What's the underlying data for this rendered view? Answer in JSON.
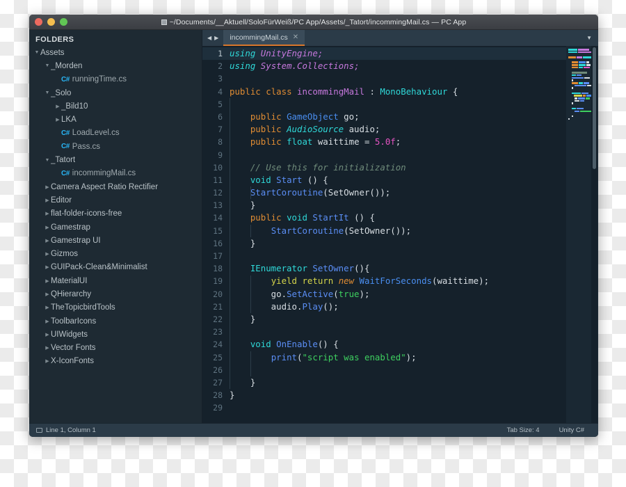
{
  "window": {
    "title": "~/Documents/__Aktuell/SoloFürWeiß/PC App/Assets/_Tatort/incommingMail.cs — PC App",
    "traffic_lights": [
      "close",
      "minimize",
      "zoom"
    ]
  },
  "sidebar": {
    "header": "FOLDERS",
    "items": [
      {
        "label": "Assets",
        "indent": 0,
        "type": "folder",
        "expanded": true
      },
      {
        "label": "_Morden",
        "indent": 1,
        "type": "folder",
        "expanded": true
      },
      {
        "label": "runningTime.cs",
        "indent": 2,
        "type": "file"
      },
      {
        "label": "_Solo",
        "indent": 1,
        "type": "folder",
        "expanded": true
      },
      {
        "label": "_Bild10",
        "indent": 2,
        "type": "folder",
        "expanded": false
      },
      {
        "label": "LKA",
        "indent": 2,
        "type": "folder",
        "expanded": false
      },
      {
        "label": "LoadLevel.cs",
        "indent": 2,
        "type": "file"
      },
      {
        "label": "Pass.cs",
        "indent": 2,
        "type": "file"
      },
      {
        "label": "_Tatort",
        "indent": 1,
        "type": "folder",
        "expanded": true
      },
      {
        "label": "incommingMail.cs",
        "indent": 2,
        "type": "file"
      },
      {
        "label": "Camera Aspect Ratio Rectifier",
        "indent": 1,
        "type": "folder",
        "expanded": false
      },
      {
        "label": "Editor",
        "indent": 1,
        "type": "folder",
        "expanded": false
      },
      {
        "label": "flat-folder-icons-free",
        "indent": 1,
        "type": "folder",
        "expanded": false
      },
      {
        "label": "Gamestrap",
        "indent": 1,
        "type": "folder",
        "expanded": false
      },
      {
        "label": "Gamestrap UI",
        "indent": 1,
        "type": "folder",
        "expanded": false
      },
      {
        "label": "Gizmos",
        "indent": 1,
        "type": "folder",
        "expanded": false
      },
      {
        "label": "GUIPack-Clean&Minimalist",
        "indent": 1,
        "type": "folder",
        "expanded": false
      },
      {
        "label": "MaterialUI",
        "indent": 1,
        "type": "folder",
        "expanded": false
      },
      {
        "label": "QHierarchy",
        "indent": 1,
        "type": "folder",
        "expanded": false
      },
      {
        "label": "TheTopicbirdTools",
        "indent": 1,
        "type": "folder",
        "expanded": false
      },
      {
        "label": "ToolbarIcons",
        "indent": 1,
        "type": "folder",
        "expanded": false
      },
      {
        "label": "UIWidgets",
        "indent": 1,
        "type": "folder",
        "expanded": false
      },
      {
        "label": "Vector Fonts",
        "indent": 1,
        "type": "folder",
        "expanded": false
      },
      {
        "label": "X-IconFonts",
        "indent": 1,
        "type": "folder",
        "expanded": false
      }
    ],
    "file_icon_label": "C#"
  },
  "tabbar": {
    "nav_prev": "◀",
    "nav_next": "▶",
    "tabs": [
      {
        "label": "incommingMail.cs",
        "active": true,
        "close": "✕"
      }
    ],
    "menu": "▼"
  },
  "editor": {
    "total_lines": 29,
    "active_line": 1,
    "lines": [
      {
        "n": 1,
        "tokens": [
          {
            "t": "using",
            "c": "k-using"
          },
          {
            "t": " "
          },
          {
            "t": "UnityEngine",
            "c": "k-ns"
          },
          {
            "t": ";",
            "c": "k-ns"
          }
        ]
      },
      {
        "n": 2,
        "tokens": [
          {
            "t": "using",
            "c": "k-using"
          },
          {
            "t": " "
          },
          {
            "t": "System.Collections",
            "c": "k-ns"
          },
          {
            "t": ";",
            "c": "k-ns"
          }
        ]
      },
      {
        "n": 3,
        "tokens": []
      },
      {
        "n": 4,
        "tokens": [
          {
            "t": "public",
            "c": "k-mod"
          },
          {
            "t": " "
          },
          {
            "t": "class",
            "c": "k-mod"
          },
          {
            "t": " "
          },
          {
            "t": "incommingMail",
            "c": "k-cls"
          },
          {
            "t": " : "
          },
          {
            "t": "MonoBehaviour",
            "c": "k-type"
          },
          {
            "t": " {"
          }
        ]
      },
      {
        "n": 5,
        "tokens": []
      },
      {
        "n": 6,
        "tokens": [
          {
            "t": "    "
          },
          {
            "t": "public",
            "c": "k-mod"
          },
          {
            "t": " "
          },
          {
            "t": "GameObject",
            "c": "k-obj"
          },
          {
            "t": " go;"
          }
        ]
      },
      {
        "n": 7,
        "tokens": [
          {
            "t": "    "
          },
          {
            "t": "public",
            "c": "k-mod"
          },
          {
            "t": " "
          },
          {
            "t": "AudioSource",
            "c": "k-typeit"
          },
          {
            "t": " audio;"
          }
        ]
      },
      {
        "n": 8,
        "tokens": [
          {
            "t": "    "
          },
          {
            "t": "public",
            "c": "k-mod"
          },
          {
            "t": " "
          },
          {
            "t": "float",
            "c": "k-type"
          },
          {
            "t": " waittime = "
          },
          {
            "t": "5.0f",
            "c": "k-num"
          },
          {
            "t": ";"
          }
        ]
      },
      {
        "n": 9,
        "tokens": []
      },
      {
        "n": 10,
        "tokens": [
          {
            "t": "    "
          },
          {
            "t": "// Use this for initialization",
            "c": "k-com"
          }
        ]
      },
      {
        "n": 11,
        "tokens": [
          {
            "t": "    "
          },
          {
            "t": "void",
            "c": "k-type"
          },
          {
            "t": " "
          },
          {
            "t": "Start",
            "c": "k-fn"
          },
          {
            "t": " () {"
          }
        ]
      },
      {
        "n": 12,
        "tokens": [
          {
            "t": "    "
          },
          {
            "t": "StartCoroutine",
            "c": "k-fn"
          },
          {
            "t": "(SetOwner());"
          }
        ]
      },
      {
        "n": 13,
        "tokens": [
          {
            "t": "    }"
          }
        ]
      },
      {
        "n": 14,
        "tokens": [
          {
            "t": "    "
          },
          {
            "t": "public",
            "c": "k-mod"
          },
          {
            "t": " "
          },
          {
            "t": "void",
            "c": "k-type"
          },
          {
            "t": " "
          },
          {
            "t": "StartIt",
            "c": "k-fn"
          },
          {
            "t": " () {"
          }
        ]
      },
      {
        "n": 15,
        "tokens": [
          {
            "t": "        "
          },
          {
            "t": "StartCoroutine",
            "c": "k-fn"
          },
          {
            "t": "(SetOwner());"
          }
        ]
      },
      {
        "n": 16,
        "tokens": [
          {
            "t": "    }"
          }
        ]
      },
      {
        "n": 17,
        "tokens": []
      },
      {
        "n": 18,
        "tokens": [
          {
            "t": "    "
          },
          {
            "t": "IEnumerator",
            "c": "k-type"
          },
          {
            "t": " "
          },
          {
            "t": "SetOwner",
            "c": "k-fn"
          },
          {
            "t": "(){"
          }
        ]
      },
      {
        "n": 19,
        "tokens": [
          {
            "t": "        "
          },
          {
            "t": "yield return",
            "c": "k-yield"
          },
          {
            "t": " "
          },
          {
            "t": "new",
            "c": "k-new"
          },
          {
            "t": " "
          },
          {
            "t": "WaitForSeconds",
            "c": "k-obj"
          },
          {
            "t": "(waittime);"
          }
        ]
      },
      {
        "n": 20,
        "tokens": [
          {
            "t": "        go."
          },
          {
            "t": "SetActive",
            "c": "k-fn"
          },
          {
            "t": "("
          },
          {
            "t": "true",
            "c": "k-bool"
          },
          {
            "t": ");"
          }
        ]
      },
      {
        "n": 21,
        "tokens": [
          {
            "t": "        audio."
          },
          {
            "t": "Play",
            "c": "k-fn"
          },
          {
            "t": "();"
          }
        ]
      },
      {
        "n": 22,
        "tokens": [
          {
            "t": "    }"
          }
        ]
      },
      {
        "n": 23,
        "tokens": []
      },
      {
        "n": 24,
        "tokens": [
          {
            "t": "    "
          },
          {
            "t": "void",
            "c": "k-type"
          },
          {
            "t": " "
          },
          {
            "t": "OnEnable",
            "c": "k-fn"
          },
          {
            "t": "() {"
          }
        ]
      },
      {
        "n": 25,
        "tokens": [
          {
            "t": "        "
          },
          {
            "t": "print",
            "c": "k-fn"
          },
          {
            "t": "("
          },
          {
            "t": "\"script was enabled\"",
            "c": "k-str"
          },
          {
            "t": ");"
          }
        ]
      },
      {
        "n": 26,
        "tokens": []
      },
      {
        "n": 27,
        "tokens": [
          {
            "t": "    }"
          }
        ]
      },
      {
        "n": 28,
        "tokens": [
          {
            "t": "}"
          }
        ]
      },
      {
        "n": 29,
        "tokens": []
      }
    ]
  },
  "minimap": {
    "rows": [
      [
        {
          "w": 13,
          "c": "#2fd8d8"
        },
        {
          "w": 16,
          "c": "#c678dd"
        }
      ],
      [
        {
          "w": 13,
          "c": "#2fd8d8"
        },
        {
          "w": 19,
          "c": "#c678dd"
        }
      ],
      [],
      [
        {
          "w": 11,
          "c": "#e08c33"
        },
        {
          "w": 8,
          "c": "#c678dd"
        },
        {
          "w": 13,
          "c": "#2fd8d8"
        }
      ],
      [],
      [
        {
          "w": 4
        },
        {
          "w": 9,
          "c": "#e08c33"
        },
        {
          "w": 10,
          "c": "#4a8ef0"
        },
        {
          "w": 4,
          "c": "#d8dee3"
        }
      ],
      [
        {
          "w": 4
        },
        {
          "w": 9,
          "c": "#e08c33"
        },
        {
          "w": 10,
          "c": "#2fd8d8"
        },
        {
          "w": 6,
          "c": "#d8dee3"
        }
      ],
      [
        {
          "w": 4
        },
        {
          "w": 9,
          "c": "#e08c33"
        },
        {
          "w": 6,
          "c": "#2fd8d8"
        },
        {
          "w": 9,
          "c": "#e754c4"
        }
      ],
      [],
      [
        {
          "w": 4
        },
        {
          "w": 22,
          "c": "#6f8b7a"
        }
      ],
      [
        {
          "w": 4
        },
        {
          "w": 6,
          "c": "#2fd8d8"
        },
        {
          "w": 7,
          "c": "#5b8ef5"
        }
      ],
      [
        {
          "w": 4
        },
        {
          "w": 17,
          "c": "#5b8ef5"
        },
        {
          "w": 8,
          "c": "#d8dee3"
        }
      ],
      [
        {
          "w": 4
        },
        {
          "w": 2,
          "c": "#d8dee3"
        }
      ],
      [
        {
          "w": 4
        },
        {
          "w": 9,
          "c": "#e08c33"
        },
        {
          "w": 6,
          "c": "#2fd8d8"
        },
        {
          "w": 8,
          "c": "#5b8ef5"
        }
      ],
      [
        {
          "w": 8
        },
        {
          "w": 17,
          "c": "#5b8ef5"
        },
        {
          "w": 7,
          "c": "#d8dee3"
        }
      ],
      [
        {
          "w": 4
        },
        {
          "w": 2,
          "c": "#d8dee3"
        }
      ],
      [],
      [
        {
          "w": 4
        },
        {
          "w": 13,
          "c": "#2fd8d8"
        },
        {
          "w": 10,
          "c": "#5b8ef5"
        }
      ],
      [
        {
          "w": 8
        },
        {
          "w": 13,
          "c": "#d4d44a"
        },
        {
          "w": 5,
          "c": "#e08c33"
        },
        {
          "w": 16,
          "c": "#4a8ef0"
        }
      ],
      [
        {
          "w": 8
        },
        {
          "w": 4,
          "c": "#d8dee3"
        },
        {
          "w": 10,
          "c": "#5b8ef5"
        },
        {
          "w": 6,
          "c": "#3ecf5f"
        }
      ],
      [
        {
          "w": 8
        },
        {
          "w": 7,
          "c": "#d8dee3"
        },
        {
          "w": 6,
          "c": "#5b8ef5"
        }
      ],
      [
        {
          "w": 4
        },
        {
          "w": 2,
          "c": "#d8dee3"
        }
      ],
      [],
      [
        {
          "w": 4
        },
        {
          "w": 6,
          "c": "#2fd8d8"
        },
        {
          "w": 10,
          "c": "#5b8ef5"
        }
      ],
      [
        {
          "w": 8
        },
        {
          "w": 7,
          "c": "#5b8ef5"
        },
        {
          "w": 18,
          "c": "#3ecf5f"
        }
      ],
      [],
      [
        {
          "w": 4
        },
        {
          "w": 2,
          "c": "#d8dee3"
        }
      ],
      [
        {
          "w": 2,
          "c": "#d8dee3"
        }
      ],
      []
    ]
  },
  "statusbar": {
    "position": "Line 1, Column 1",
    "tab_size": "Tab Size: 4",
    "syntax": "Unity C#"
  }
}
